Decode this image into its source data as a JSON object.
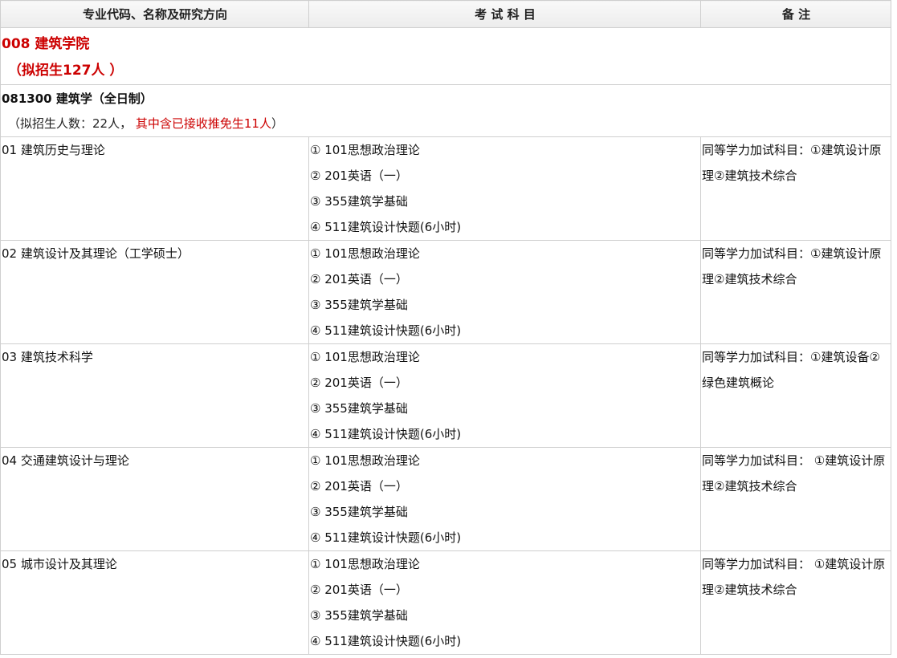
{
  "header": {
    "col1": "专业代码、名称及研究方向",
    "col2": "考 试 科 目",
    "col3": "备 注"
  },
  "department": {
    "name": "008 建筑学院",
    "quota": "（拟招生127人 ）"
  },
  "major": {
    "name": "081300 建筑学（全日制）",
    "quota_prefix": "（拟招生人数：22人，",
    "quota_highlight": "其中含已接收推免生11人",
    "quota_suffix": "）"
  },
  "directions": [
    {
      "name": "01 建筑历史与理论",
      "subjects": [
        "① 101思想政治理论",
        "② 201英语（一）",
        "③ 355建筑学基础",
        "④ 511建筑设计快题(6小时)"
      ],
      "note": "同等学力加试科目：①建筑设计原理②建筑技术综合"
    },
    {
      "name": "02 建筑设计及其理论（工学硕士）",
      "subjects": [
        "① 101思想政治理论",
        "② 201英语（一）",
        "③ 355建筑学基础",
        "④ 511建筑设计快题(6小时)"
      ],
      "note": "同等学力加试科目：①建筑设计原理②建筑技术综合"
    },
    {
      "name": "03 建筑技术科学",
      "subjects": [
        "① 101思想政治理论",
        "② 201英语（一）",
        "③ 355建筑学基础",
        "④ 511建筑设计快题(6小时)"
      ],
      "note": "同等学力加试科目：①建筑设备②绿色建筑概论"
    },
    {
      "name": "04 交通建筑设计与理论",
      "subjects": [
        "① 101思想政治理论",
        "② 201英语（一）",
        "③ 355建筑学基础",
        "④ 511建筑设计快题(6小时)"
      ],
      "note": "同等学力加试科目： ①建筑设计原理②建筑技术综合"
    },
    {
      "name": "05 城市设计及其理论",
      "subjects": [
        "① 101思想政治理论",
        "② 201英语（一）",
        "③ 355建筑学基础",
        "④ 511建筑设计快题(6小时)"
      ],
      "note": "同等学力加试科目： ①建筑设计原理②建筑技术综合"
    }
  ]
}
